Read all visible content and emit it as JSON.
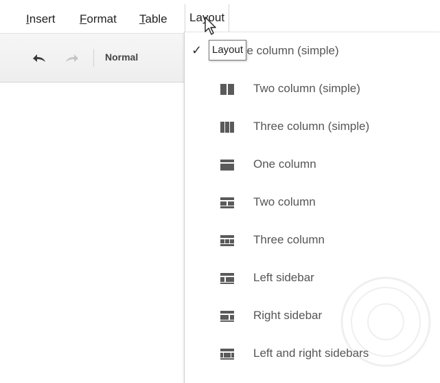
{
  "menubar": {
    "items": [
      {
        "accel": "I",
        "rest": "nsert"
      },
      {
        "accel": "F",
        "rest": "ormat"
      },
      {
        "accel": "T",
        "rest": "able"
      },
      {
        "pre": "La",
        "accel": "y",
        "rest": "out"
      }
    ]
  },
  "toolbar": {
    "undo_icon": "undo-icon",
    "redo_icon": "redo-icon",
    "style_value": "Normal"
  },
  "tooltip": {
    "text": "Layout"
  },
  "layout_menu": {
    "checkmark": "✓",
    "first_item_visible_text": "ne column (simple)",
    "items": [
      {
        "label": "Two column (simple)",
        "icon": "two-column-simple-icon"
      },
      {
        "label": "Three column (simple)",
        "icon": "three-column-simple-icon"
      },
      {
        "label": "One column",
        "icon": "one-column-icon"
      },
      {
        "label": "Two column",
        "icon": "two-column-icon"
      },
      {
        "label": "Three column",
        "icon": "three-column-icon"
      },
      {
        "label": "Left sidebar",
        "icon": "left-sidebar-icon"
      },
      {
        "label": "Right sidebar",
        "icon": "right-sidebar-icon"
      },
      {
        "label": "Left and right sidebars",
        "icon": "left-right-sidebars-icon"
      }
    ]
  },
  "colors": {
    "icon": "#5a5a5a",
    "menu_text": "#555555",
    "toolbar_bg": "#f1f1f1"
  }
}
